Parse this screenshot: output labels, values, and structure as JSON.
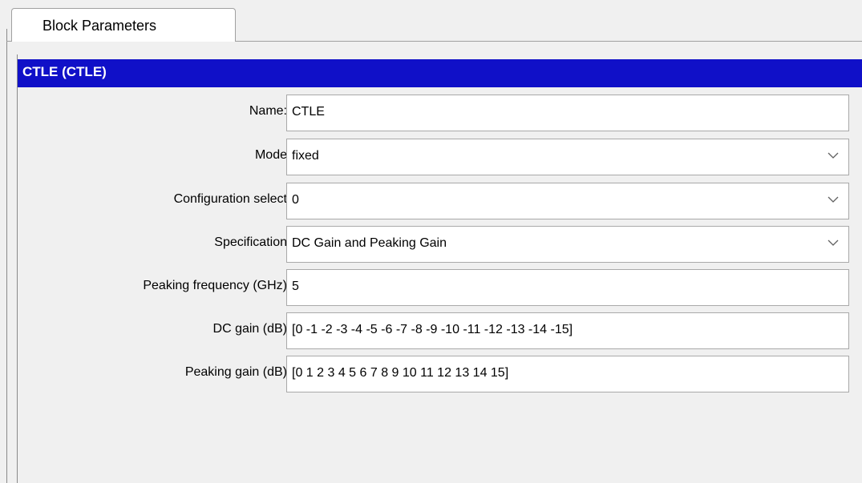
{
  "tabs": [
    {
      "label": "Block Parameters"
    }
  ],
  "header": {
    "title": "CTLE  (CTLE)"
  },
  "accent_color": "#1010c8",
  "params": [
    {
      "label": "Name:",
      "value": "CTLE",
      "type": "text"
    },
    {
      "label": "Mode",
      "value": "fixed",
      "type": "select"
    },
    {
      "label": "Configuration select",
      "value": "0",
      "type": "select"
    },
    {
      "label": "Specification",
      "value": "DC Gain and Peaking Gain",
      "type": "select"
    },
    {
      "label": "Peaking frequency (GHz)",
      "value": "5",
      "type": "text"
    },
    {
      "label": "DC gain (dB)",
      "value": "[0 -1 -2 -3 -4 -5 -6 -7 -8 -9 -10 -11 -12 -13 -14 -15]",
      "type": "text"
    },
    {
      "label": "Peaking gain (dB)",
      "value": "[0 1 2 3 4 5 6 7 8 9 10 11 12 13 14 15]",
      "type": "text"
    }
  ],
  "icons": {
    "dropdown": "chevron-down-icon"
  }
}
